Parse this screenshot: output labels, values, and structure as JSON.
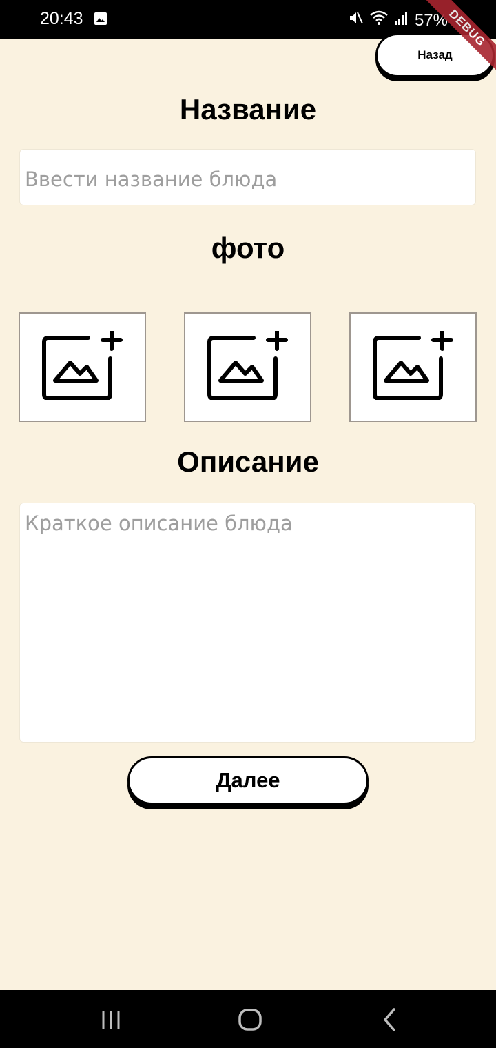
{
  "status_bar": {
    "time": "20:43",
    "battery": "57%"
  },
  "debug_label": "DEBUG",
  "header": {
    "back_label": "Назад"
  },
  "form": {
    "name_heading": "Название",
    "name_placeholder": "Ввести название блюда",
    "photo_heading": "фото",
    "photos": [
      {
        "icon": "add-photo-icon"
      },
      {
        "icon": "add-photo-icon"
      },
      {
        "icon": "add-photo-icon"
      }
    ],
    "description_heading": "Описание",
    "description_placeholder": "Краткое описание блюда",
    "next_label": "Далее"
  },
  "nav_bar": {
    "items": [
      "recent-apps-icon",
      "home-icon",
      "back-icon"
    ]
  },
  "colors": {
    "background": "#faf2e0",
    "debug": "#a8252f"
  }
}
